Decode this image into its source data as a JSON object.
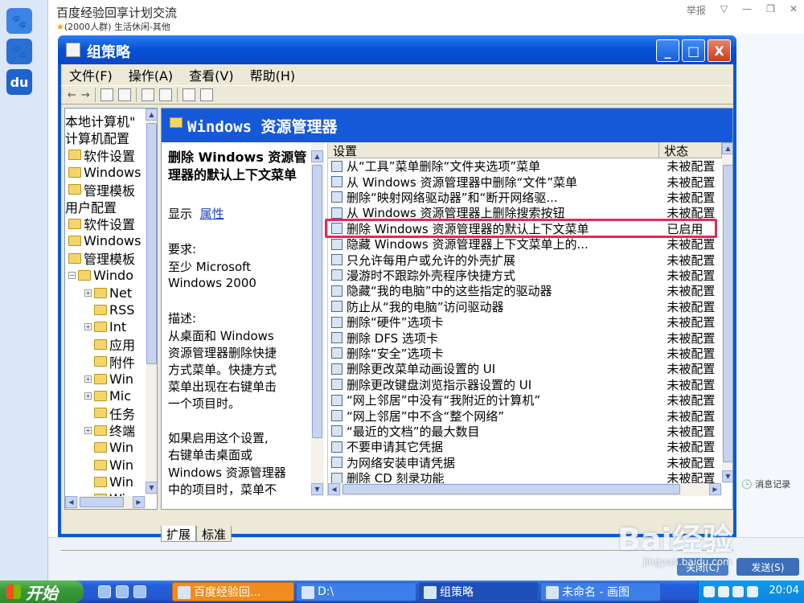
{
  "chat": {
    "title": "百度经验回享计划交流",
    "subtitle": "(2000人群) 生活休闲-其他",
    "report": "举报",
    "msg_log": "消息记录",
    "close_btn": "关闭(C)",
    "send_btn": "发送(S)"
  },
  "watermark": {
    "logo": "Bai经验",
    "url": "jingyan.baidu.com"
  },
  "window": {
    "title": "组策略",
    "minimize": "_",
    "maximize": "□",
    "close": "X"
  },
  "menu": [
    "文件(F)",
    "操作(A)",
    "查看(V)",
    "帮助(H)"
  ],
  "tree": {
    "items": [
      {
        "label": "本地计算机\"",
        "indent": 0,
        "folder": false,
        "exp": ""
      },
      {
        "label": "计算机配置",
        "indent": 0,
        "folder": false,
        "exp": ""
      },
      {
        "label": "软件设置",
        "indent": 0,
        "folder": true,
        "exp": ""
      },
      {
        "label": "Windows",
        "indent": 0,
        "folder": true,
        "exp": ""
      },
      {
        "label": "管理模板",
        "indent": 0,
        "folder": true,
        "exp": ""
      },
      {
        "label": "用户配置",
        "indent": 0,
        "folder": false,
        "exp": ""
      },
      {
        "label": "软件设置",
        "indent": 0,
        "folder": true,
        "exp": ""
      },
      {
        "label": "Windows",
        "indent": 0,
        "folder": true,
        "exp": ""
      },
      {
        "label": "管理模板",
        "indent": 0,
        "folder": true,
        "exp": ""
      },
      {
        "label": "Windo",
        "indent": 1,
        "folder": true,
        "exp": "−"
      },
      {
        "label": "Net",
        "indent": 2,
        "folder": true,
        "exp": "+"
      },
      {
        "label": "RSS",
        "indent": 2,
        "folder": true,
        "exp": ""
      },
      {
        "label": "Int",
        "indent": 2,
        "folder": true,
        "exp": "+"
      },
      {
        "label": "应用",
        "indent": 2,
        "folder": true,
        "exp": ""
      },
      {
        "label": "附件",
        "indent": 2,
        "folder": true,
        "exp": ""
      },
      {
        "label": "Win",
        "indent": 2,
        "folder": true,
        "exp": "+"
      },
      {
        "label": "Mic",
        "indent": 2,
        "folder": true,
        "exp": "+"
      },
      {
        "label": "任务",
        "indent": 2,
        "folder": true,
        "exp": ""
      },
      {
        "label": "终端",
        "indent": 2,
        "folder": true,
        "exp": "+"
      },
      {
        "label": "Win",
        "indent": 2,
        "folder": true,
        "exp": ""
      },
      {
        "label": "Win",
        "indent": 2,
        "folder": true,
        "exp": ""
      },
      {
        "label": "Win",
        "indent": 2,
        "folder": true,
        "exp": ""
      },
      {
        "label": "Win",
        "indent": 2,
        "folder": true,
        "exp": ""
      }
    ]
  },
  "pane": {
    "header": "Windows 资源管理器",
    "ext_title_1": "删除 Windows 资源管",
    "ext_title_2": "理器的默认上下文菜单",
    "display_label": "显示",
    "display_link": "属性",
    "req_label": "要求:",
    "req_1": "至少 Microsoft",
    "req_2": "Windows 2000",
    "desc_label": "描述:",
    "desc_1": "从桌面和 Windows",
    "desc_2": "资源管理器删除快捷",
    "desc_3": "方式菜单。快捷方式",
    "desc_4": "菜单出现在右键单击",
    "desc_5": "一个项目时。",
    "if_1": "如果启用这个设置,",
    "if_2": "右键单击桌面或",
    "if_3": "Windows 资源管理器",
    "if_4": "中的项目时，菜单不",
    "col_setting": "设置",
    "col_state": "状态"
  },
  "rows": [
    {
      "name": "从“工具”菜单删除“文件夹选项”菜单",
      "state": "未被配置"
    },
    {
      "name": "从 Windows 资源管理器中删除“文件”菜单",
      "state": "未被配置"
    },
    {
      "name": "删除“映射网络驱动器”和“断开网络驱...",
      "state": "未被配置"
    },
    {
      "name": "从 Windows 资源管理器上删除搜索按钮",
      "state": "未被配置"
    },
    {
      "name": "删除 Windows 资源管理器的默认上下文菜单",
      "state": "已启用"
    },
    {
      "name": "隐藏 Windows 资源管理器上下文菜单上的...",
      "state": "未被配置"
    },
    {
      "name": "只允许每用户或允许的外壳扩展",
      "state": "未被配置"
    },
    {
      "name": "漫游时不跟踪外壳程序快捷方式",
      "state": "未被配置"
    },
    {
      "name": "隐藏“我的电脑”中的这些指定的驱动器",
      "state": "未被配置"
    },
    {
      "name": "防止从“我的电脑”访问驱动器",
      "state": "未被配置"
    },
    {
      "name": "删除“硬件”选项卡",
      "state": "未被配置"
    },
    {
      "name": "删除 DFS 选项卡",
      "state": "未被配置"
    },
    {
      "name": "删除“安全”选项卡",
      "state": "未被配置"
    },
    {
      "name": "删除更改菜单动画设置的 UI",
      "state": "未被配置"
    },
    {
      "name": "删除更改键盘浏览指示器设置的 UI",
      "state": "未被配置"
    },
    {
      "name": "“网上邻居”中没有“我附近的计算机”",
      "state": "未被配置"
    },
    {
      "name": "“网上邻居”中不含“整个网络”",
      "state": "未被配置"
    },
    {
      "name": "“最近的文档”的最大数目",
      "state": "未被配置"
    },
    {
      "name": "不要申请其它凭据",
      "state": "未被配置"
    },
    {
      "name": "为网络安装申请凭据",
      "state": "未被配置"
    },
    {
      "name": "删除 CD 刻录功能",
      "state": "未被配置"
    }
  ],
  "highlight_index": 4,
  "tabs": [
    "扩展",
    "标准"
  ],
  "taskbar": {
    "start": "开始",
    "tasks": [
      "百度经验回...",
      "D:\\",
      "组策略",
      "未命名 - 画图"
    ],
    "clock": "20:04"
  },
  "colors": {
    "accent": "#0a58d8",
    "highlight_border": "#e22b55",
    "link": "#1a44c4"
  }
}
